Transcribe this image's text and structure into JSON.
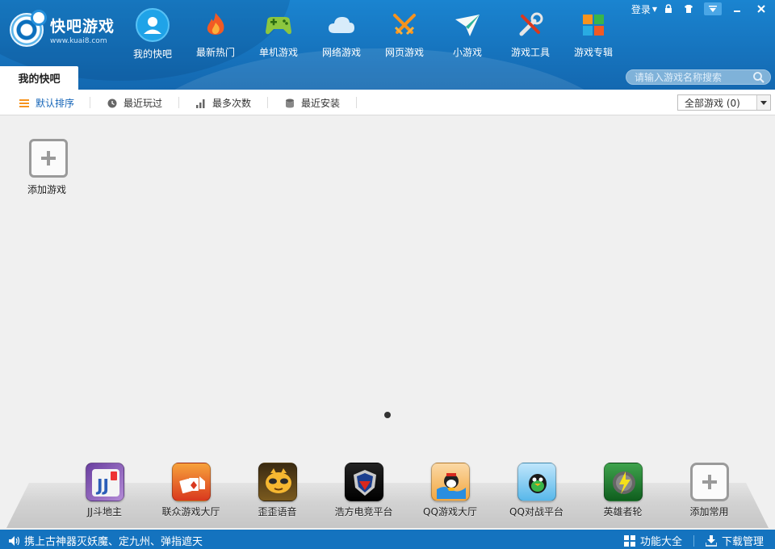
{
  "app": {
    "title": "快吧游戏",
    "url": "www.kuai8.com"
  },
  "window_controls": {
    "login_label": "登录"
  },
  "nav": [
    {
      "label": "我的快吧",
      "icon": "user-icon"
    },
    {
      "label": "最新热门",
      "icon": "flame-icon"
    },
    {
      "label": "单机游戏",
      "icon": "gamepad-icon"
    },
    {
      "label": "网络游戏",
      "icon": "cloud-icon"
    },
    {
      "label": "网页游戏",
      "icon": "crossed-swords-icon"
    },
    {
      "label": "小游戏",
      "icon": "paper-plane-icon"
    },
    {
      "label": "游戏工具",
      "icon": "tools-icon"
    },
    {
      "label": "游戏专辑",
      "icon": "grid-icon"
    }
  ],
  "tab": {
    "label": "我的快吧"
  },
  "search": {
    "placeholder": "请输入游戏名称搜索"
  },
  "toolbar": {
    "sorts": [
      {
        "label": "默认排序",
        "icon": "list-icon",
        "active": true
      },
      {
        "label": "最近玩过",
        "icon": "clock-icon"
      },
      {
        "label": "最多次数",
        "icon": "bar-chart-icon"
      },
      {
        "label": "最近安装",
        "icon": "database-icon"
      }
    ],
    "filter_value": "全部游戏 (0)"
  },
  "content": {
    "add_game_label": "添加游戏"
  },
  "dock": [
    {
      "label": "JJ斗地主",
      "icon": "jj-app-icon"
    },
    {
      "label": "联众游戏大厅",
      "icon": "lianzhong-app-icon"
    },
    {
      "label": "歪歪语音",
      "icon": "yy-voice-app-icon"
    },
    {
      "label": "浩方电竞平台",
      "icon": "haofang-app-icon"
    },
    {
      "label": "QQ游戏大厅",
      "icon": "qq-game-app-icon"
    },
    {
      "label": "QQ对战平台",
      "icon": "qq-battle-app-icon"
    },
    {
      "label": "英雄者轮",
      "icon": "hero-app-icon"
    },
    {
      "label": "添加常用",
      "icon": "add-common-icon"
    }
  ],
  "status": {
    "news": "携上古神器灭妖魔、定九州、弹指遮天",
    "features_label": "功能大全",
    "download_label": "下载管理"
  }
}
